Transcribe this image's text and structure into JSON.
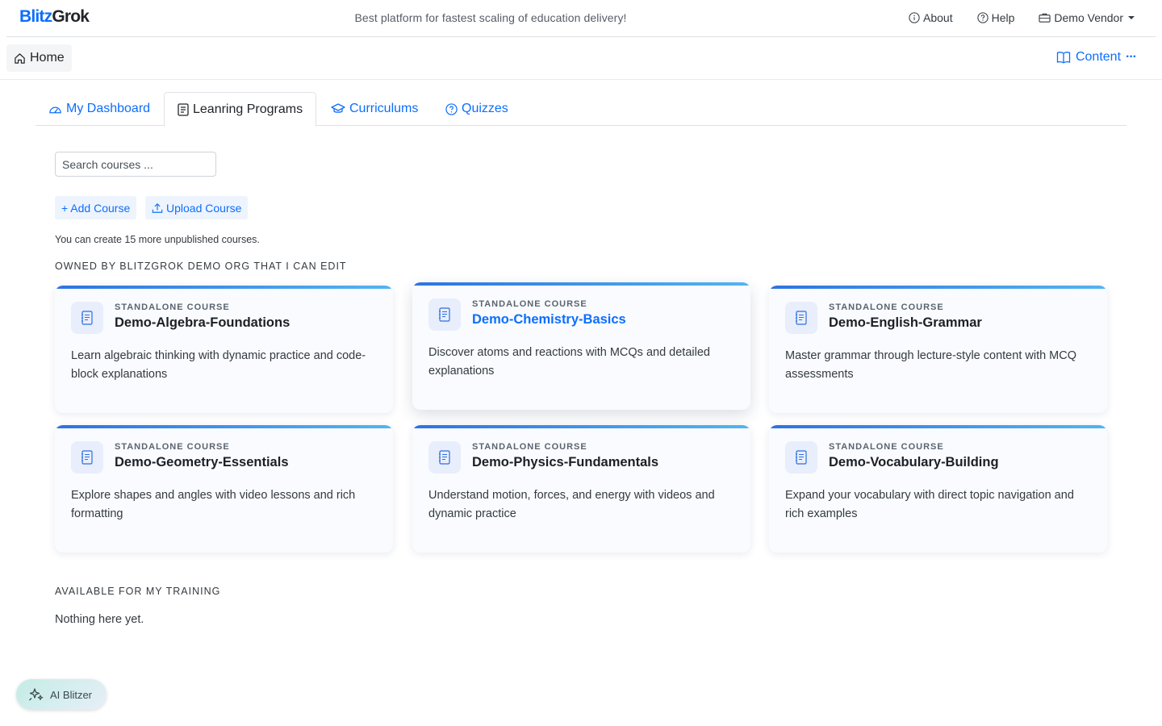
{
  "brand": {
    "part1": "Blitz",
    "part2": "Grok"
  },
  "tagline": "Best platform for fastest scaling of education delivery!",
  "topnav": {
    "about": "About",
    "help": "Help",
    "vendor": "Demo Vendor"
  },
  "subbar": {
    "home": "Home",
    "content": "Content",
    "more": "···"
  },
  "tabs": [
    {
      "label": "My Dashboard",
      "active": false
    },
    {
      "label": "Leanring Programs",
      "active": true
    },
    {
      "label": "Curriculums",
      "active": false
    },
    {
      "label": "Quizzes",
      "active": false
    }
  ],
  "search": {
    "placeholder": "Search courses ..."
  },
  "actions": {
    "add": "+ Add Course",
    "upload": "Upload Course"
  },
  "note": "You can create 15 more unpublished courses.",
  "owned_title": "OWNED BY BLITZGROK DEMO ORG THAT I CAN EDIT",
  "courses": [
    {
      "kind": "STANDALONE COURSE",
      "title": "Demo-Algebra-Foundations",
      "desc": "Learn algebraic thinking with dynamic practice and code-block explanations"
    },
    {
      "kind": "STANDALONE COURSE",
      "title": "Demo-Chemistry-Basics",
      "desc": "Discover atoms and reactions with MCQs and detailed explanations"
    },
    {
      "kind": "STANDALONE COURSE",
      "title": "Demo-English-Grammar",
      "desc": "Master grammar through lecture-style content with MCQ assessments"
    },
    {
      "kind": "STANDALONE COURSE",
      "title": "Demo-Geometry-Essentials",
      "desc": "Explore shapes and angles with video lessons and rich formatting"
    },
    {
      "kind": "STANDALONE COURSE",
      "title": "Demo-Physics-Fundamentals",
      "desc": "Understand motion, forces, and energy with videos and dynamic practice"
    },
    {
      "kind": "STANDALONE COURSE",
      "title": "Demo-Vocabulary-Building",
      "desc": "Expand your vocabulary with direct topic navigation and rich examples"
    }
  ],
  "training_title": "AVAILABLE FOR MY TRAINING",
  "training_empty": "Nothing here yet.",
  "ai_button": "AI Blitzer",
  "colors": {
    "accent": "#0d6efd",
    "card_bar_start": "#2d73e0",
    "card_bar_end": "#53b4f1"
  }
}
